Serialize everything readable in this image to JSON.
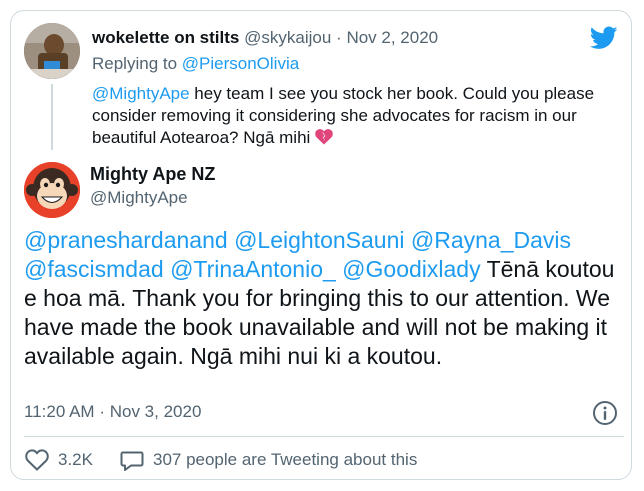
{
  "parent_tweet": {
    "author_name": "wokelette on stilts",
    "author_handle": "@skykaijou",
    "separator": "·",
    "date": "Nov 2, 2020",
    "replying_prefix": "Replying to ",
    "replying_to": "@PiersonOlivia",
    "mention": "@MightyApe",
    "text": " hey team I see you stock her book. Could you please consider removing it considering she advocates for racism in our beautiful Aotearoa? Ngā mihi "
  },
  "main_tweet": {
    "author_name": "Mighty Ape NZ",
    "author_handle": "@MightyApe",
    "mentions": [
      "@praneshardanand",
      "@LeightonSauni",
      "@Rayna_Davis",
      "@fascismdad",
      "@TrinaAntonio_",
      "@Goodixlady"
    ],
    "text": " Tēnā koutou e hoa mā. Thank you for bringing this to our attention. We have made the book unavailable and will not be making it available again. Ngā mihi nui ki a koutou.",
    "time": "11:20 AM",
    "separator": "·",
    "date": "Nov 3, 2020"
  },
  "footer": {
    "like_count": "3.2K",
    "tweeting_text": "307 people are Tweeting about this"
  },
  "icons": {
    "brand": "twitter-bird-icon",
    "heart_emoji": "heart-emoji-icon",
    "info": "info-icon",
    "like": "heart-outline-icon",
    "reply": "speech-bubble-icon"
  },
  "colors": {
    "link": "#1d9bf0",
    "secondary_text": "#536471",
    "primary_text": "#0f1419",
    "border": "#cfd9de",
    "brand_red": "#e8412a"
  }
}
